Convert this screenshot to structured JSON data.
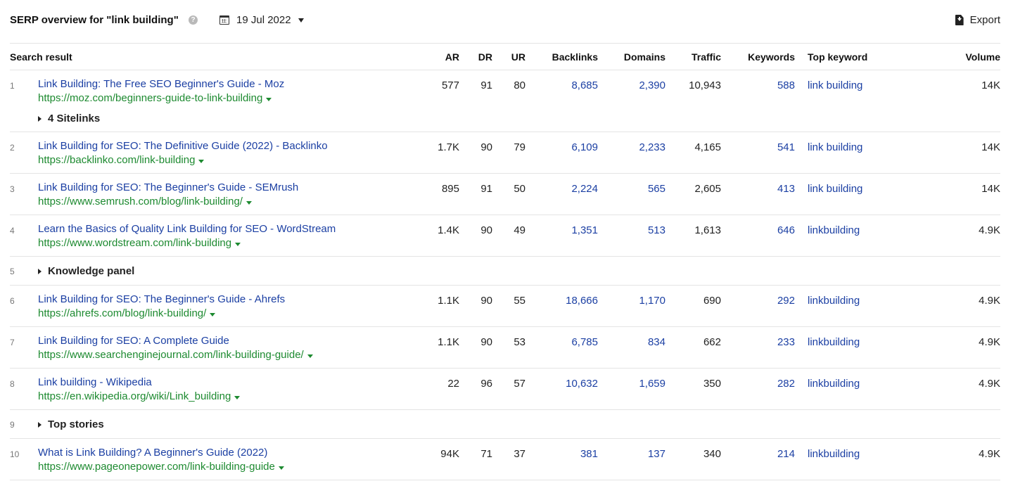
{
  "header": {
    "title": "SERP overview for \"link building\"",
    "help_icon": "?",
    "date": "19 Jul 2022",
    "export_label": "Export"
  },
  "columns": {
    "search_result": "Search result",
    "ar": "AR",
    "dr": "DR",
    "ur": "UR",
    "backlinks": "Backlinks",
    "domains": "Domains",
    "traffic": "Traffic",
    "keywords": "Keywords",
    "top_keyword": "Top keyword",
    "volume": "Volume"
  },
  "rows": [
    {
      "rank": "1",
      "title": "Link Building: The Free SEO Beginner's Guide - Moz",
      "url": "https://moz.com/beginners-guide-to-link-building",
      "ar": "577",
      "dr": "91",
      "ur": "80",
      "backlinks": "8,685",
      "domains": "2,390",
      "traffic": "10,943",
      "keywords": "588",
      "top_keyword": "link building",
      "volume": "14K",
      "sitelinks": "4 Sitelinks"
    },
    {
      "rank": "2",
      "title": "Link Building for SEO: The Definitive Guide (2022) - Backlinko",
      "url": "https://backlinko.com/link-building",
      "ar": "1.7K",
      "dr": "90",
      "ur": "79",
      "backlinks": "6,109",
      "domains": "2,233",
      "traffic": "4,165",
      "keywords": "541",
      "top_keyword": "link building",
      "volume": "14K"
    },
    {
      "rank": "3",
      "title": "Link Building for SEO: The Beginner's Guide - SEMrush",
      "url": "https://www.semrush.com/blog/link-building/",
      "ar": "895",
      "dr": "91",
      "ur": "50",
      "backlinks": "2,224",
      "domains": "565",
      "traffic": "2,605",
      "keywords": "413",
      "top_keyword": "link building",
      "volume": "14K"
    },
    {
      "rank": "4",
      "title": "Learn the Basics of Quality Link Building for SEO - WordStream",
      "url": "https://www.wordstream.com/link-building",
      "ar": "1.4K",
      "dr": "90",
      "ur": "49",
      "backlinks": "1,351",
      "domains": "513",
      "traffic": "1,613",
      "keywords": "646",
      "top_keyword": "linkbuilding",
      "volume": "4.9K"
    },
    {
      "rank": "5",
      "special": "Knowledge panel"
    },
    {
      "rank": "6",
      "title": "Link Building for SEO: The Beginner's Guide - Ahrefs",
      "url": "https://ahrefs.com/blog/link-building/",
      "ar": "1.1K",
      "dr": "90",
      "ur": "55",
      "backlinks": "18,666",
      "domains": "1,170",
      "traffic": "690",
      "keywords": "292",
      "top_keyword": "linkbuilding",
      "volume": "4.9K"
    },
    {
      "rank": "7",
      "title": "Link Building for SEO: A Complete Guide",
      "url": "https://www.searchenginejournal.com/link-building-guide/",
      "ar": "1.1K",
      "dr": "90",
      "ur": "53",
      "backlinks": "6,785",
      "domains": "834",
      "traffic": "662",
      "keywords": "233",
      "top_keyword": "linkbuilding",
      "volume": "4.9K"
    },
    {
      "rank": "8",
      "title": "Link building - Wikipedia",
      "url": "https://en.wikipedia.org/wiki/Link_building",
      "ar": "22",
      "dr": "96",
      "ur": "57",
      "backlinks": "10,632",
      "domains": "1,659",
      "traffic": "350",
      "keywords": "282",
      "top_keyword": "linkbuilding",
      "volume": "4.9K"
    },
    {
      "rank": "9",
      "special": "Top stories"
    },
    {
      "rank": "10",
      "title": "What is Link Building? A Beginner's Guide (2022)",
      "url": "https://www.pageonepower.com/link-building-guide",
      "ar": "94K",
      "dr": "71",
      "ur": "37",
      "backlinks": "381",
      "domains": "137",
      "traffic": "340",
      "keywords": "214",
      "top_keyword": "linkbuilding",
      "volume": "4.9K"
    }
  ],
  "colors": {
    "link_blue": "#1b3fa3",
    "url_green": "#1d8a30",
    "border": "#e4e4e4"
  }
}
